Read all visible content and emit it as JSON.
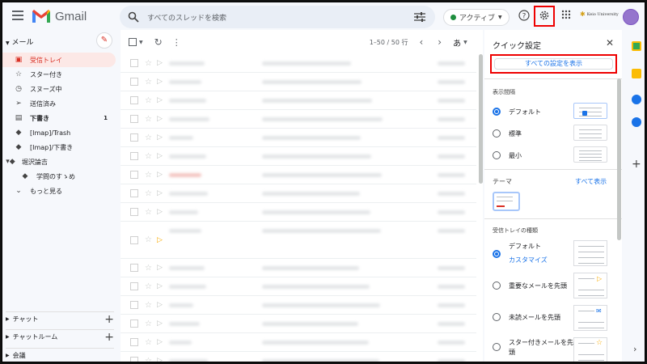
{
  "app": {
    "name": "Gmail"
  },
  "search": {
    "placeholder": "すべてのスレッドを検索"
  },
  "status": {
    "label": "アクティブ"
  },
  "org": {
    "name": "Keio University"
  },
  "sidebar": {
    "section_label": "メール",
    "items": [
      {
        "icon": "inbox-icon",
        "label": "受信トレイ",
        "count": ""
      },
      {
        "icon": "star-icon",
        "label": "スター付き",
        "count": ""
      },
      {
        "icon": "clock-icon",
        "label": "スヌーズ中",
        "count": ""
      },
      {
        "icon": "send-icon",
        "label": "送信済み",
        "count": ""
      },
      {
        "icon": "draft-icon",
        "label": "下書き",
        "count": "1"
      },
      {
        "icon": "label-icon",
        "label": "[Imap]/Trash",
        "count": ""
      },
      {
        "icon": "label-icon",
        "label": "[Imap]/下書き",
        "count": ""
      },
      {
        "icon": "label-icon",
        "label": "堀沢論吉",
        "count": ""
      },
      {
        "icon": "label-icon",
        "label": "学問のすゝめ",
        "count": ""
      },
      {
        "icon": "chevron-down-icon",
        "label": "もっと見る",
        "count": ""
      }
    ],
    "bottom": [
      {
        "label": "チャット"
      },
      {
        "label": "チャットルーム"
      },
      {
        "label": "会議"
      }
    ]
  },
  "toolbar": {
    "range": "1–50 / 50 行",
    "input_tool": "あ"
  },
  "quick_settings": {
    "title": "クイック設定",
    "all_settings": "すべての設定を表示",
    "density": {
      "label": "表示間隔",
      "options": [
        {
          "label": "デフォルト",
          "selected": true
        },
        {
          "label": "標準",
          "selected": false
        },
        {
          "label": "最小",
          "selected": false
        }
      ]
    },
    "theme": {
      "label": "テーマ",
      "link": "すべて表示"
    },
    "inbox_type": {
      "label": "受信トレイの種類",
      "options": [
        {
          "label": "デフォルト",
          "link": "カスタマイズ",
          "selected": true
        },
        {
          "label": "重要なメールを先頭",
          "selected": false
        },
        {
          "label": "未読メールを先頭",
          "selected": false
        },
        {
          "label": "スター付きメールを先頭",
          "selected": false
        }
      ]
    }
  },
  "colors": {
    "accent": "#1a73e8",
    "selected_bg": "#fce8e6",
    "highlight": "#ee0000"
  }
}
